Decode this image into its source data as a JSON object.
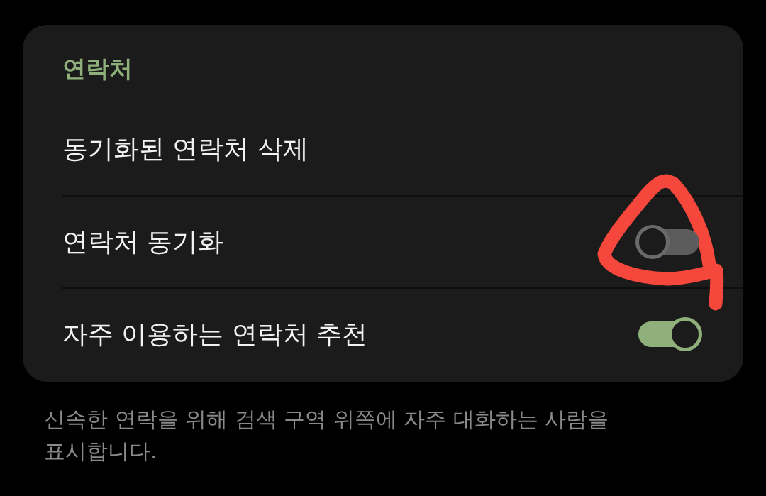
{
  "section": {
    "title": "연락처",
    "rows": [
      {
        "kind": "action",
        "label": "동기화된 연락처 삭제",
        "circled": false
      },
      {
        "kind": "toggle",
        "label": "연락처 동기화",
        "on": false,
        "circled": true
      },
      {
        "kind": "toggle",
        "label": "자주 이용하는 연락처 추천",
        "on": true,
        "circled": false
      }
    ]
  },
  "footnote": "신속한 연락을 위해 검색 구역 위쪽에 자주 대화하는 사람을 표시합니다."
}
